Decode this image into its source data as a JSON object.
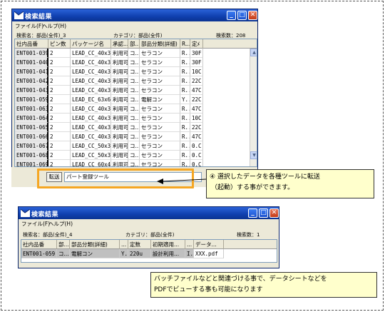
{
  "window1": {
    "title": "検索結果",
    "menu": [
      "ファイル(F)",
      "ヘルプ(H)"
    ],
    "info": {
      "left": "検索名：部品(全件)_3",
      "center": "カテゴリ：部品(全件)",
      "right": "検索数：208"
    },
    "columns": [
      "社内品番",
      "ピン数",
      "パッケージ名",
      "承認...",
      "部...",
      "部品分類(詳細)",
      "R...",
      "定ﾒ"
    ],
    "rows": [
      [
        "ENT001-039",
        "2",
        "LEAD_CC_40x35",
        "利用可",
        "コ...",
        "セラコン",
        "R...",
        "30F"
      ],
      [
        "ENT001-040",
        "2",
        "LEAD_CC_40x35",
        "利用可",
        "コ...",
        "セラコン",
        "R...",
        "30F"
      ],
      [
        "ENT001-041",
        "2",
        "LEAD_CC_40x35",
        "利用可",
        "コ...",
        "セラコン",
        "R...",
        "10C"
      ],
      [
        "ENT001-042",
        "2",
        "LEAD_CC_40x35",
        "利用可",
        "コ...",
        "セラコン",
        "R...",
        "22C"
      ],
      [
        "ENT001-043",
        "2",
        "LEAD_CC_40x35",
        "利用可",
        "コ...",
        "セラコン",
        "R...",
        "47C"
      ],
      [
        "ENT001-059",
        "2",
        "LEAD_EC_63x63",
        "利用可",
        "コ...",
        "電解コン",
        "Y...",
        "22C"
      ],
      [
        "ENT001-063",
        "2",
        "LEAD_CC_40x35",
        "利用可",
        "コ...",
        "セラコン",
        "R...",
        "47C"
      ],
      [
        "ENT001-064",
        "2",
        "LEAD_CC_40x35",
        "利用可",
        "コ...",
        "セラコン",
        "R...",
        "10C"
      ],
      [
        "ENT001-065",
        "2",
        "LEAD_CC_40x35",
        "利用可",
        "コ...",
        "セラコン",
        "R...",
        "22C"
      ],
      [
        "ENT001-066",
        "2",
        "LEAD_CC_40x35",
        "利用可",
        "コ...",
        "セラコン",
        "R...",
        "47C"
      ],
      [
        "ENT001-067",
        "2",
        "LEAD_CC_50x35",
        "利用可",
        "コ...",
        "セラコン",
        "R...",
        "0.C"
      ],
      [
        "ENT001-068",
        "2",
        "LEAD_CC_50x35",
        "利用可",
        "コ...",
        "セラコン",
        "R...",
        "0.C"
      ],
      [
        "ENT001-069",
        "2",
        "LEAD_CC_60x40",
        "利用可",
        "コ...",
        "セラコン",
        "R...",
        "0.C"
      ]
    ],
    "transfer_button": "転送",
    "tool_select": "パート登録ツール"
  },
  "window2": {
    "title": "検索結果",
    "menu": [
      "ファイル(F)",
      "ヘルプ(H)"
    ],
    "info": {
      "left": "検索名：部品(全件)_4",
      "center": "カテゴリ：部品(全件)",
      "right": "検索数：1"
    },
    "columns": [
      "社内品番",
      "部...",
      "部品分類(詳細)",
      "...",
      "定数",
      "初期適用...",
      "...",
      "データ..."
    ],
    "rows": [
      [
        "ENT001-059",
        "コ...",
        "電解コン",
        "Y...",
        "220u",
        "設計利用...",
        "I...",
        "XXX.pdf"
      ]
    ]
  },
  "callout1": {
    "line1": "④ 選択したデータを各種ツールに転送",
    "line2": "（起動）する事ができます。"
  },
  "callout2": {
    "line1": "バッチファイルなどと関連づける事で、データシートなどを",
    "line2": "PDFでビューする事も可能になります"
  },
  "colors": {
    "highlight": "#f5a623",
    "callout_bg": "#ffffcc",
    "titlebar": "#0f3fae"
  }
}
